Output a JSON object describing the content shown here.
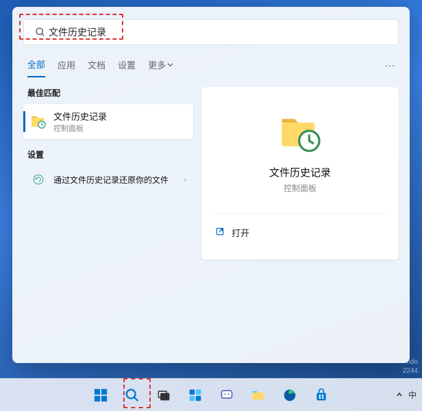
{
  "search": {
    "value": "文件历史记录"
  },
  "tabs": [
    "全部",
    "应用",
    "文档",
    "设置"
  ],
  "tabs_more": "更多",
  "sections": {
    "best_match": "最佳匹配",
    "settings": "设置"
  },
  "results": {
    "primary": {
      "title": "文件历史记录",
      "subtitle": "控制面板"
    },
    "settings_item": {
      "title": "通过文件历史记录还原你的文件"
    }
  },
  "preview": {
    "title": "文件历史记录",
    "subtitle": "控制面板",
    "open_label": "打开"
  },
  "watermark": {
    "line1": "ndo",
    "line2": "2244"
  },
  "tray": {
    "lang": "中"
  }
}
